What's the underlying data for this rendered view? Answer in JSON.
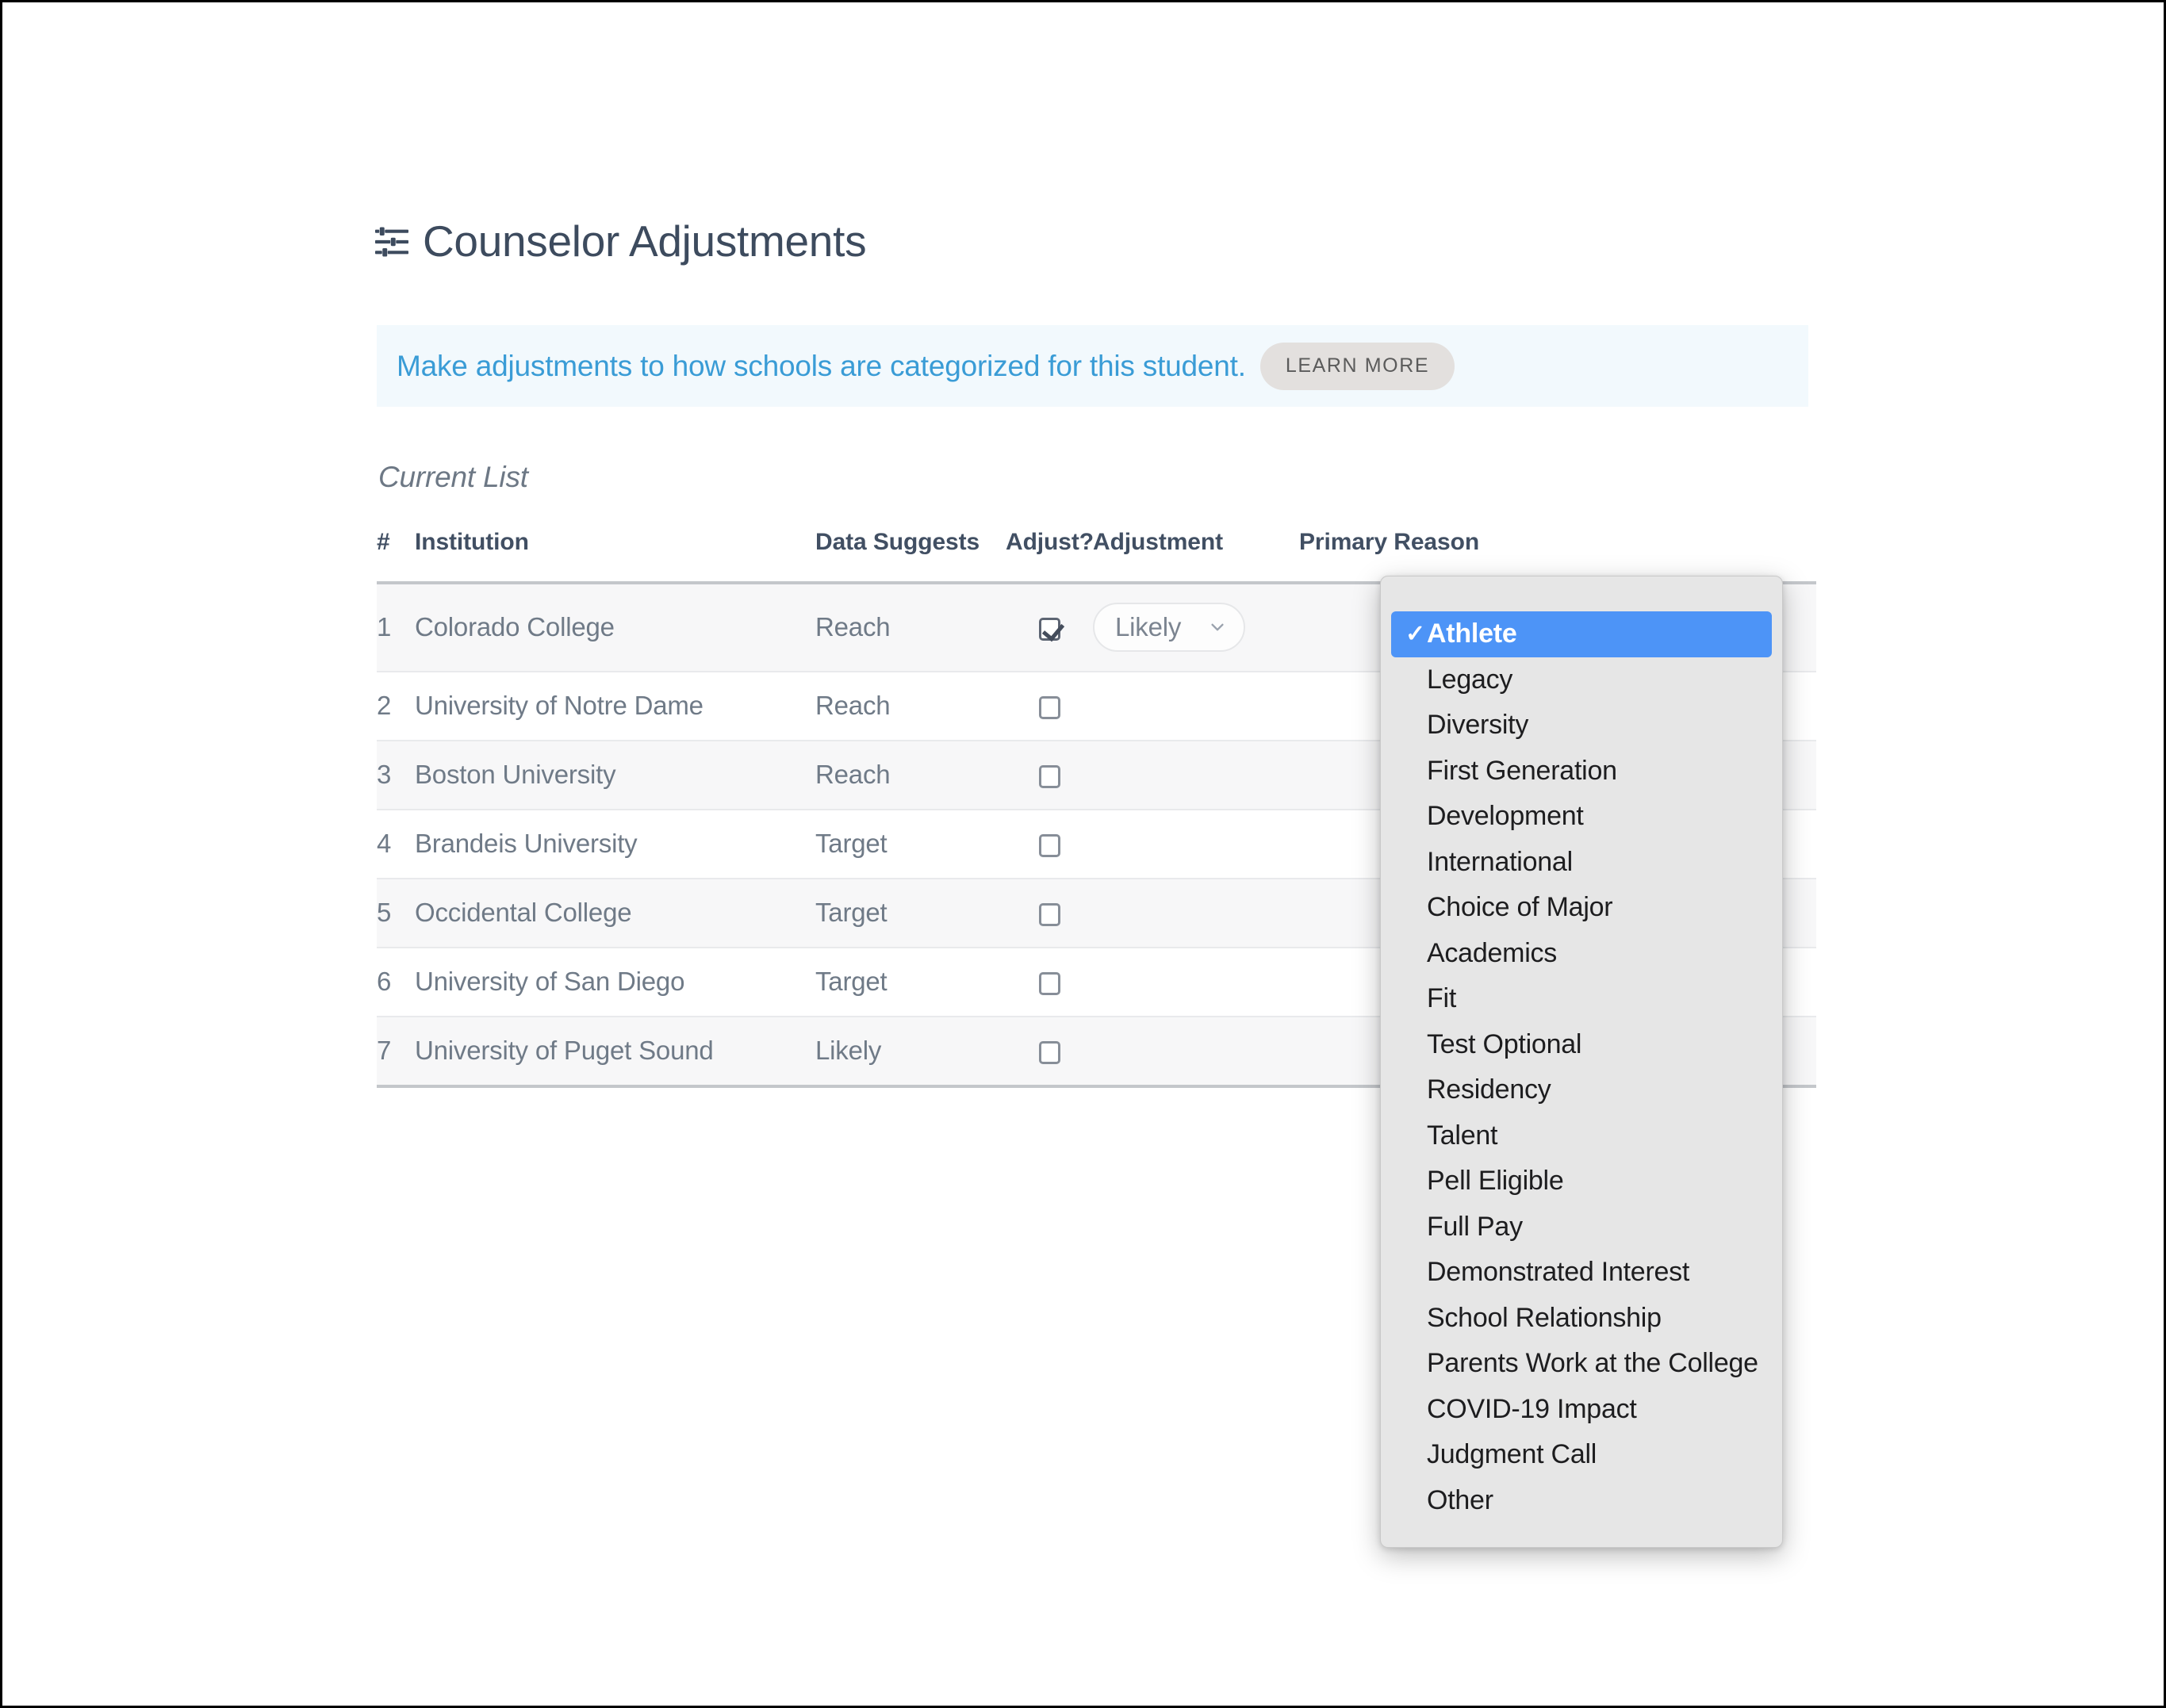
{
  "header": {
    "icon": "sliders-icon",
    "title": "Counselor Adjustments"
  },
  "banner": {
    "message": "Make adjustments to how schools are categorized for this student.",
    "learn_more_label": "LEARN MORE",
    "background_color": "#f2f9fd",
    "text_color": "#3a9cd6"
  },
  "section": {
    "current_list_label": "Current List"
  },
  "table": {
    "columns": [
      "#",
      "Institution",
      "Data Suggests",
      "Adjust?",
      "Adjustment",
      "Primary Reason"
    ],
    "rows": [
      {
        "num": "1",
        "institution": "Colorado College",
        "data_suggests": "Reach",
        "adjust_checked": true,
        "adjustment": "Likely",
        "primary_reason": ""
      },
      {
        "num": "2",
        "institution": "University of Notre Dame",
        "data_suggests": "Reach",
        "adjust_checked": false,
        "adjustment": "",
        "primary_reason": ""
      },
      {
        "num": "3",
        "institution": "Boston University",
        "data_suggests": "Reach",
        "adjust_checked": false,
        "adjustment": "",
        "primary_reason": ""
      },
      {
        "num": "4",
        "institution": "Brandeis University",
        "data_suggests": "Target",
        "adjust_checked": false,
        "adjustment": "",
        "primary_reason": ""
      },
      {
        "num": "5",
        "institution": "Occidental College",
        "data_suggests": "Target",
        "adjust_checked": false,
        "adjustment": "",
        "primary_reason": ""
      },
      {
        "num": "6",
        "institution": "University of San Diego",
        "data_suggests": "Target",
        "adjust_checked": false,
        "adjustment": "",
        "primary_reason": ""
      },
      {
        "num": "7",
        "institution": "University of Puget Sound",
        "data_suggests": "Likely",
        "adjust_checked": false,
        "adjustment": "",
        "primary_reason": ""
      }
    ]
  },
  "primary_reason_dropdown": {
    "open": true,
    "selected": "Athlete",
    "highlight_color": "#4d94f7",
    "background_color": "#e6e6e6",
    "options": [
      "Athlete",
      "Legacy",
      "Diversity",
      "First Generation",
      "Development",
      "International",
      "Choice of Major",
      "Academics",
      "Fit",
      "Test Optional",
      "Residency",
      "Talent",
      "Pell Eligible",
      "Full Pay",
      "Demonstrated Interest",
      "School Relationship",
      "Parents Work at the College",
      "COVID-19 Impact",
      "Judgment Call",
      "Other"
    ]
  }
}
